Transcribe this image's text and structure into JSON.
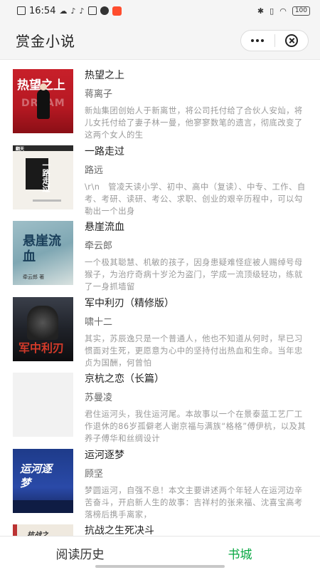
{
  "status_bar": {
    "time": "16:54",
    "battery": "100"
  },
  "header": {
    "title": "赏金小说"
  },
  "colors": {
    "accent_green": "#07a842",
    "desc_gray": "#999999"
  },
  "books": [
    {
      "title": "热望之上",
      "author": "蒋离子",
      "desc": "新灿集团创始人于新离世，将公司托付给了合伙人安灿，将儿女托付给了妻子林一曼，他寥寥数笔的遗言，彻底改变了这两个女人的生",
      "cover": {
        "text_main": "热望之上",
        "text_sub": "DREAM"
      }
    },
    {
      "title": "一路走过",
      "author": "路远",
      "desc": "\\r\\n　管凌天读小学、初中、高中（复读）、中专、工作、自考、考研、读研、考公、求职、创业的艰辛历程中，可以勾勒出一个出身",
      "cover": {
        "text_main": "一路走过",
        "text_sub": "翻天"
      }
    },
    {
      "title": "悬崖流血",
      "author": "牵云郎",
      "desc": "一个极其聪慧、机敏的孩子，因身患疑难怪症被人赐绰号母猴子，为治疗奇病十岁沦为盗门，学成一流顶级轻功，练就了一身抓墙留",
      "cover": {
        "text_main": "悬崖流血",
        "text_sub": "牵云郎 著"
      }
    },
    {
      "title": "军中利刃（精修版）",
      "author": "啸十二",
      "desc": "其实，苏辰逸只是一个普通人，他也不知道从何时，早已习惯面对生死，更愿意为心中的坚持付出热血和生命。当年忠贞为国酬，何曾怕",
      "cover": {
        "text_main": "军中利刃"
      }
    },
    {
      "title": "京杭之恋（长篇）",
      "author": "苏曼凌",
      "desc": "君住运河头，我住运河尾。本故事以一个在景泰蓝工艺厂工作退休的86岁孤僻老人谢京福与满族“格格”傅伊杭，以及其养子傅华和丝绸设计",
      "cover": {}
    },
    {
      "title": "运河逐梦",
      "author": "顾坚",
      "desc": "梦圆运河，自强不息！本文主要讲述两个年轻人在运河边辛苦奋斗，开启新人生的故事：吉祥村的张来福、沈喜宝高考落榜后携手离家，",
      "cover": {
        "text_main": "运河逐梦"
      }
    },
    {
      "title": "抗战之生死决斗",
      "author": "",
      "desc": "",
      "cover": {
        "text_main": "抗战之"
      }
    }
  ],
  "tabbar": {
    "history": "阅读历史",
    "store": "书城"
  }
}
